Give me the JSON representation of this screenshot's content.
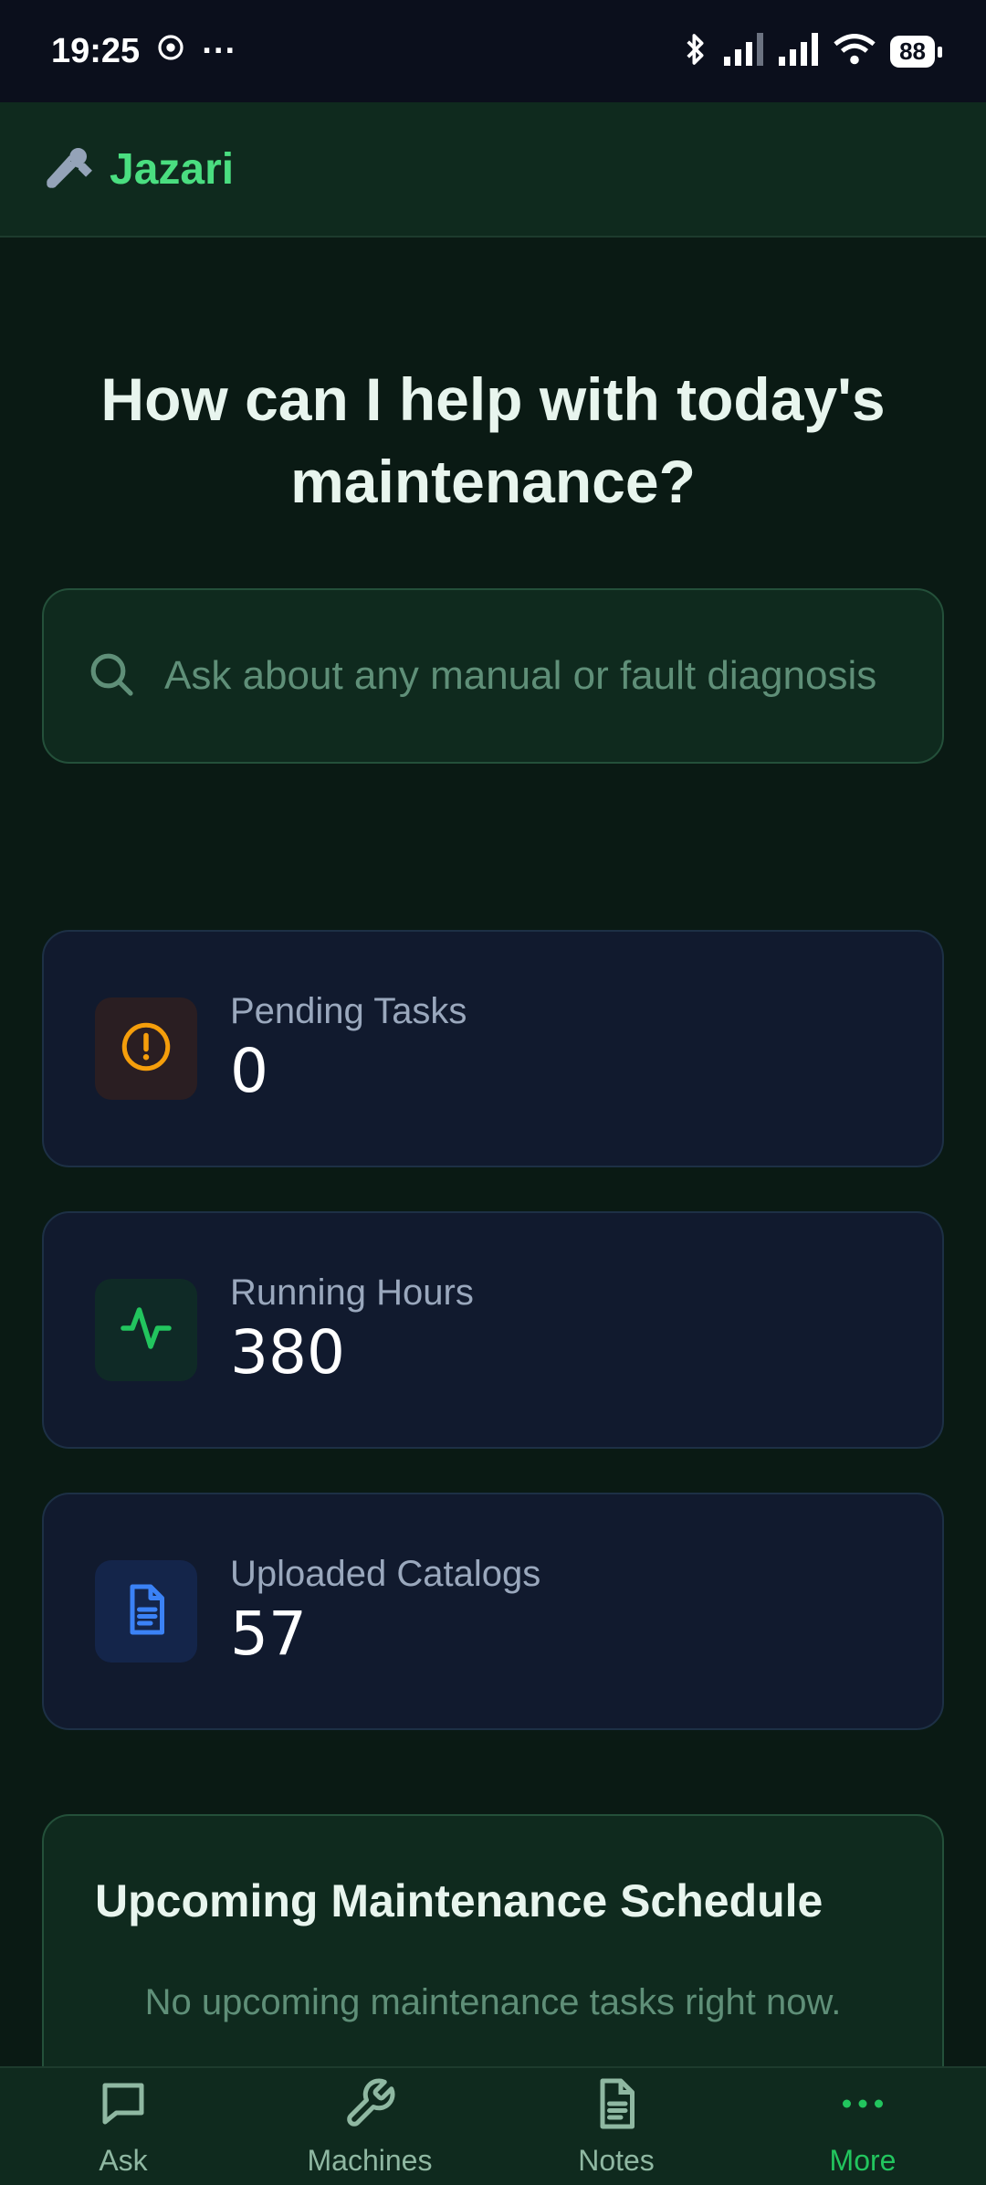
{
  "status_bar": {
    "time": "19:25",
    "more": "···",
    "battery": "88"
  },
  "header": {
    "icon": "wrench-icon",
    "title": "Jazari"
  },
  "hero": {
    "title": "How can I help with today's maintenance?"
  },
  "search": {
    "placeholder": "Ask about any manual or fault diagnosis"
  },
  "stats": [
    {
      "label": "Pending Tasks",
      "value": "0",
      "icon": "alert-circle-icon",
      "color": "#f59e0b"
    },
    {
      "label": "Running Hours",
      "value": "380",
      "icon": "activity-icon",
      "color": "#22c55e"
    },
    {
      "label": "Uploaded Catalogs",
      "value": "57",
      "icon": "document-icon",
      "color": "#3b82f6"
    }
  ],
  "schedule": {
    "title": "Upcoming Maintenance Schedule",
    "empty_text": "No upcoming maintenance tasks right now."
  },
  "nav": {
    "items": [
      {
        "label": "Ask",
        "icon": "chat-icon"
      },
      {
        "label": "Machines",
        "icon": "wrench-icon"
      },
      {
        "label": "Notes",
        "icon": "notes-icon"
      },
      {
        "label": "More",
        "icon": "more-icon"
      }
    ],
    "active": "More"
  },
  "colors": {
    "accent": "#4ade80",
    "background": "#0a1a14",
    "card": "#111a2e",
    "panel": "#0f2a1e"
  }
}
